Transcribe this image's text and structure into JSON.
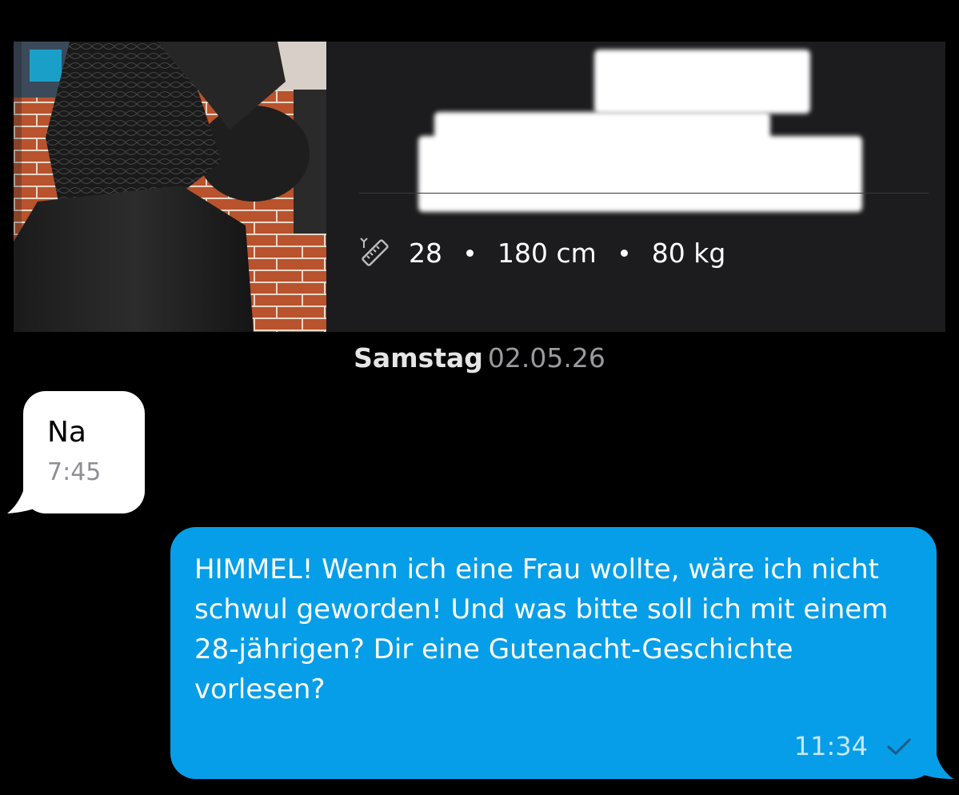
{
  "profile": {
    "stats": {
      "age": "28",
      "height": "180 cm",
      "weight": "80 kg"
    },
    "icons": {
      "measure": "ruler-icon"
    }
  },
  "date_separator": {
    "day": "Samstag",
    "date": "02.05.26"
  },
  "messages": [
    {
      "direction": "incoming",
      "text": "Na",
      "time": "7:45"
    },
    {
      "direction": "outgoing",
      "text": "HIMMEL! Wenn ich eine Frau wollte, wäre ich nicht schwul geworden! Und was bitte soll ich mit einem 28-jährigen? Dir eine Gutenacht-Geschichte vorlesen?",
      "time": "11:34",
      "status_icon": "check-icon"
    }
  ],
  "colors": {
    "background": "#000000",
    "card": "#1c1c1e",
    "incoming_bubble": "#ffffff",
    "outgoing_bubble": "#069ee8",
    "timestamp_incoming": "#8e8e93",
    "timestamp_outgoing": "#c7e6f9"
  }
}
